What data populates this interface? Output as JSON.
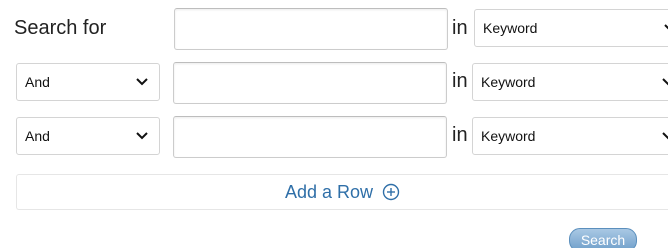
{
  "search_label": "Search for",
  "in_label": "in",
  "rows": [
    {
      "operator": null,
      "term": {
        "value": "",
        "placeholder": ""
      },
      "field": "Keyword"
    },
    {
      "operator": "And",
      "term": {
        "value": "",
        "placeholder": ""
      },
      "field": "Keyword"
    },
    {
      "operator": "And",
      "term": {
        "value": "",
        "placeholder": ""
      },
      "field": "Keyword"
    }
  ],
  "add_row_label": "Add a Row",
  "search_button_label": "Search",
  "colors": {
    "link": "#2f6fa8",
    "button_top": "#a9c8e4",
    "button_bottom": "#6f9fca"
  },
  "icons": {
    "chevron": "chevron-down-icon",
    "add": "plus-circle-icon"
  }
}
